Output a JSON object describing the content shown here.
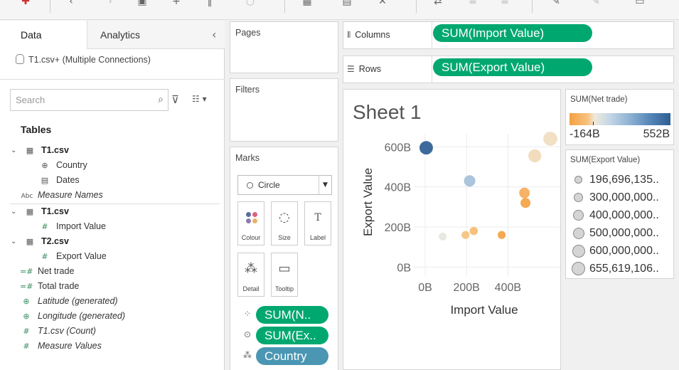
{
  "left_panel": {
    "tabs": [
      {
        "label": "Data"
      },
      {
        "label": "Analytics"
      }
    ],
    "connection": "T1.csv+ (Multiple Connections)",
    "search_placeholder": "Search",
    "tables_header": "Tables",
    "rows": [
      {
        "label": "T1.csv",
        "kind": "table",
        "icon": "table-icon"
      },
      {
        "label": "Country",
        "kind": "dim",
        "icon": "globe-icon"
      },
      {
        "label": "Dates",
        "kind": "dim",
        "icon": "calendar-icon"
      },
      {
        "label": "Measure Names",
        "kind": "dim-italic",
        "icon": "abc-icon"
      },
      {
        "label": "T1.csv",
        "kind": "table",
        "icon": "table-icon"
      },
      {
        "label": "Import Value",
        "kind": "measure",
        "icon": "hash-icon"
      },
      {
        "label": "T2.csv",
        "kind": "table",
        "icon": "table-icon"
      },
      {
        "label": "Export Value",
        "kind": "measure",
        "icon": "hash-icon"
      },
      {
        "label": "Net trade",
        "kind": "calc",
        "icon": "calc-hash-icon"
      },
      {
        "label": "Total trade",
        "kind": "calc",
        "icon": "calc-hash-icon"
      },
      {
        "label": "Latitude (generated)",
        "kind": "geo",
        "icon": "globe-icon"
      },
      {
        "label": "Longitude (generated)",
        "kind": "geo",
        "icon": "globe-icon"
      },
      {
        "label": "T1.csv (Count)",
        "kind": "count",
        "icon": "hash-icon"
      },
      {
        "label": "Measure Values",
        "kind": "count",
        "icon": "hash-icon"
      }
    ],
    "row_icons": {
      "table-icon": "▦",
      "globe-icon": "⊕",
      "calendar-icon": "▤",
      "abc-icon": "Abc",
      "hash-icon": "#",
      "calc-hash-icon": "=#"
    }
  },
  "cards": {
    "pages": "Pages",
    "filters": "Filters",
    "marks": "Marks",
    "mark_type": "Circle",
    "mark_buttons": [
      {
        "label": "Colour",
        "icon": "colour-icon"
      },
      {
        "label": "Size",
        "icon": "size-icon"
      },
      {
        "label": "Label",
        "icon": "label-icon"
      },
      {
        "label": "Detail",
        "icon": "detail-icon"
      },
      {
        "label": "Tooltip",
        "icon": "tooltip-icon"
      }
    ],
    "mark_pills": [
      {
        "label": "SUM(N..",
        "color": "#00a870",
        "icon": "colour-icon"
      },
      {
        "label": "SUM(Ex..",
        "color": "#00a870",
        "icon": "size-icon"
      },
      {
        "label": "Country",
        "color": "#4a96b3",
        "icon": "detail-icon"
      }
    ]
  },
  "shelves": {
    "columns_label": "Columns",
    "columns_pill": "SUM(Import Value)",
    "rows_label": "Rows",
    "rows_pill": "SUM(Export Value)"
  },
  "sheet": {
    "title": "Sheet 1"
  },
  "chart_data": {
    "type": "scatter",
    "xlabel": "Import Value",
    "ylabel": "Export Value",
    "x_ticks": [
      "0B",
      "200B",
      "400B"
    ],
    "y_ticks": [
      "0B",
      "200B",
      "400B",
      "600B"
    ],
    "xlim": [
      -55,
      660
    ],
    "ylim": [
      -45,
      665
    ],
    "color_range": [
      -164,
      552
    ],
    "points": [
      {
        "x": 5,
        "y": 595,
        "net": 540
      },
      {
        "x": 215,
        "y": 430,
        "net": 260
      },
      {
        "x": 85,
        "y": 152,
        "net": 90
      },
      {
        "x": 195,
        "y": 160,
        "net": -40
      },
      {
        "x": 235,
        "y": 180,
        "net": -60
      },
      {
        "x": 370,
        "y": 160,
        "net": -150
      },
      {
        "x": 480,
        "y": 370,
        "net": -110
      },
      {
        "x": 485,
        "y": 320,
        "net": -150
      },
      {
        "x": 530,
        "y": 555,
        "net": 30
      },
      {
        "x": 605,
        "y": 640,
        "net": 40
      }
    ]
  },
  "legends": {
    "colour_title": "SUM(Net trade)",
    "colour_min": "-164B",
    "colour_max": "552B",
    "colour_stops": [
      "#f4a043",
      "#f7c27e",
      "#eee9dc",
      "#c3d6e6",
      "#8db1d2",
      "#5586b8",
      "#2f5e91"
    ],
    "size_title": "SUM(Export Value)",
    "size_items": [
      "196,696,135..",
      "300,000,000..",
      "400,000,000..",
      "500,000,000..",
      "600,000,000..",
      "655,619,106.."
    ]
  },
  "toolbar": {
    "icons": [
      "new-datasource-icon",
      "back-icon",
      "forward-icon",
      "save-icon",
      "add-sheet-icon",
      "pause-icon",
      "refresh-icon",
      "new-worksheet-icon",
      "duplicate-icon",
      "clear-icon",
      "swap-icon",
      "sort-asc-icon",
      "sort-desc-icon",
      "highlight-icon",
      "annotate-icon",
      "fit-icon"
    ]
  }
}
